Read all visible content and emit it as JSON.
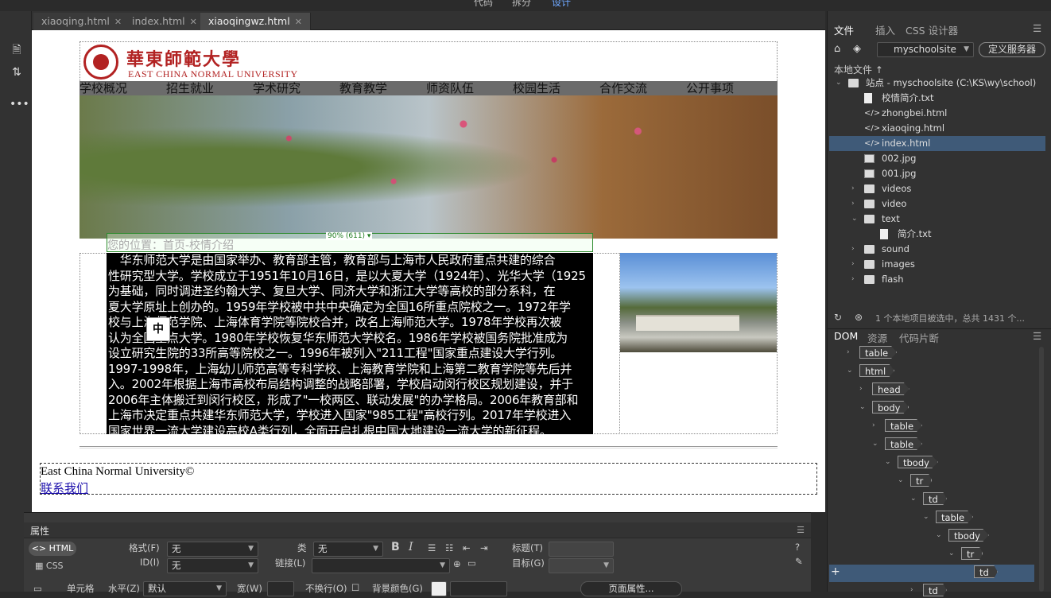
{
  "menu": {
    "code": "代码",
    "split": "拆分",
    "design": "设计"
  },
  "tabs": [
    {
      "label": "xiaoqing.html"
    },
    {
      "label": "index.html"
    },
    {
      "label": "xiaoqingwz.html",
      "active": true
    }
  ],
  "page": {
    "logo_cn": "華東師範大學",
    "logo_en": "EAST CHINA NORMAL UNIVERSITY",
    "nav": [
      "学校概况",
      "招生就业",
      "学术研究",
      "教育教学",
      "师资队伍",
      "校园生活",
      "合作交流",
      "公开事项"
    ],
    "breadcrumb": "您的位置：首页-校情介绍",
    "width_tag": "90% (611) ▾",
    "body_lines": [
      "　华东师范大学是由国家举办、教育部主管，教育部与上海市人民政府重点共建的综合",
      "性研究型大学。学校成立于1951年10月16日，是以大夏大学（1924年）、光华大学（1925",
      "为基础，同时调进圣约翰大学、复旦大学、同济大学和浙江大学等高校的部分系科，在",
      "夏大学原址上创办的。1959年学校被中共中央确定为全国16所重点院校之一。1972年学",
      "校与上海师范学院、上海体育学院等院校合并，改名上海师范大学。1978年学校再次被",
      "认为全国重点大学。1980年学校恢复华东师范大学校名。1986年学校被国务院批准成为",
      "设立研究生院的33所高等院校之一。1996年被列入\"211工程\"国家重点建设大学行列。",
      "1997-1998年，上海幼儿师范高等专科学校、上海教育学院和上海第二教育学院等先后并",
      "入。2002年根据上海市高校布局结构调整的战略部署，学校启动闵行校区规划建设，并于",
      "2006年主体搬迁到闵行校区，形成了\"一校两区、联动发展\"的办学格局。2006年教育部和",
      "上海市决定重点共建华东师范大学，学校进入国家\"985工程\"高校行列。2017年学校进入",
      "国家世界一流大学建设高校A类行列，全面开启扎根中国大地建设一流大学的新征程。"
    ],
    "ime": "中",
    "footer_copy": "East China Normal University©",
    "footer_link": "联系我们"
  },
  "properties": {
    "title": "属性",
    "html_btn": "<> HTML",
    "css_btn": "CSS",
    "format_label": "格式(F)",
    "format_value": "无",
    "id_label": "ID(I)",
    "id_value": "无",
    "class_label": "类",
    "class_value": "无",
    "link_label": "链接(L)",
    "title_label": "标题(T)",
    "target_label": "目标(G)",
    "cell_label": "单元格",
    "horiz_label": "水平(Z)",
    "horiz_value": "默认",
    "width_label": "宽(W)",
    "nowrap_label": "不换行(O)",
    "bgcolor_label": "背景颜色(G)",
    "page_props": "页面属性..."
  },
  "right_panel": {
    "tabs": [
      "文件",
      "插入",
      "CSS 设计器"
    ],
    "site": "myschoolsite",
    "define_server": "定义服务器",
    "local_files": "本地文件 ↑",
    "tree": [
      {
        "label": "站点 - myschoolsite (C:\\KS\\wy\\school)",
        "type": "folder",
        "indent": 0,
        "expanded": true
      },
      {
        "label": "校情简介.txt",
        "type": "file",
        "indent": 1
      },
      {
        "label": "zhongbei.html",
        "type": "code",
        "indent": 1
      },
      {
        "label": "xiaoqing.html",
        "type": "code",
        "indent": 1
      },
      {
        "label": "index.html",
        "type": "code",
        "indent": 1,
        "selected": true
      },
      {
        "label": "002.jpg",
        "type": "img",
        "indent": 1
      },
      {
        "label": "001.jpg",
        "type": "img",
        "indent": 1
      },
      {
        "label": "videos",
        "type": "folder",
        "indent": 1
      },
      {
        "label": "video",
        "type": "folder",
        "indent": 1
      },
      {
        "label": "text",
        "type": "folder",
        "indent": 1,
        "expanded": true
      },
      {
        "label": "简介.txt",
        "type": "file",
        "indent": 2
      },
      {
        "label": "sound",
        "type": "folder",
        "indent": 1
      },
      {
        "label": "images",
        "type": "folder",
        "indent": 1
      },
      {
        "label": "flash",
        "type": "folder",
        "indent": 1
      }
    ],
    "status": "1 个本地项目被选中，总共 1431 个...",
    "dom_tabs": [
      "DOM",
      "资源",
      "代码片断"
    ],
    "dom": [
      {
        "tag": "table",
        "level": 0,
        "arrow": "›"
      },
      {
        "tag": "html",
        "level": 0,
        "arrow": "⌄"
      },
      {
        "tag": "head",
        "level": 1,
        "arrow": "›"
      },
      {
        "tag": "body",
        "level": 1,
        "arrow": "⌄"
      },
      {
        "tag": "table",
        "level": 2,
        "arrow": "›"
      },
      {
        "tag": "table",
        "level": 2,
        "arrow": "⌄"
      },
      {
        "tag": "tbody",
        "level": 3,
        "arrow": "⌄"
      },
      {
        "tag": "tr",
        "level": 4,
        "arrow": "⌄"
      },
      {
        "tag": "td",
        "level": 5,
        "arrow": "⌄"
      },
      {
        "tag": "table",
        "level": 6,
        "arrow": "⌄"
      },
      {
        "tag": "tbody",
        "level": 7,
        "arrow": "⌄"
      },
      {
        "tag": "tr",
        "level": 8,
        "arrow": "⌄"
      },
      {
        "tag": "td",
        "level": 9,
        "arrow": ""
      },
      {
        "tag": "td",
        "level": 5,
        "arrow": "›"
      }
    ]
  }
}
